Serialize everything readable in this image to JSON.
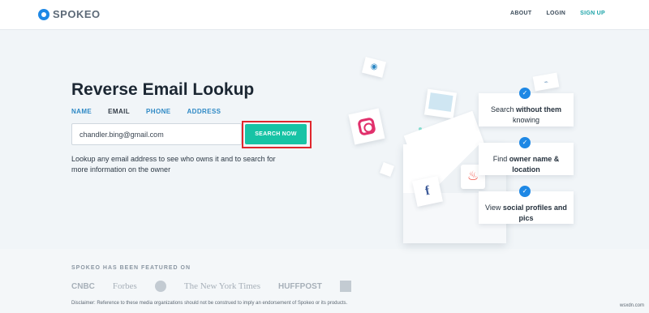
{
  "header": {
    "logo_text": "SPOKEO",
    "nav": [
      "ABOUT",
      "LOGIN",
      "SIGN UP"
    ]
  },
  "hero": {
    "title": "Reverse Email Lookup",
    "tabs": [
      "NAME",
      "EMAIL",
      "PHONE",
      "ADDRESS"
    ],
    "active_tab": "EMAIL",
    "search": {
      "value": "chandler.bing@gmail.com",
      "button_label": "SEARCH NOW"
    },
    "description": "Lookup any email address to see who owns it and to search for more information on the owner"
  },
  "features": [
    {
      "pre": "Search ",
      "bold": "without them",
      "post": "",
      "line2": "knowing"
    },
    {
      "pre": "Find ",
      "bold": "owner name &",
      "post": "",
      "line2": "location"
    },
    {
      "pre": "View ",
      "bold": "social profiles and",
      "post": "",
      "line2": "pics"
    }
  ],
  "featured": {
    "title": "SPOKEO HAS BEEN FEATURED ON",
    "media": [
      "CNBC",
      "Forbes",
      "The New York Times",
      "HUFFPOST"
    ],
    "disclaimer": "Disclaimer: Reference to these media organizations should not be construed to imply an endorsement of Spokeo or its products."
  },
  "watermark": "wsxdn.com",
  "colors": {
    "accent": "#17c3a5",
    "link": "#2e89c5",
    "highlight": "#e0262d"
  }
}
